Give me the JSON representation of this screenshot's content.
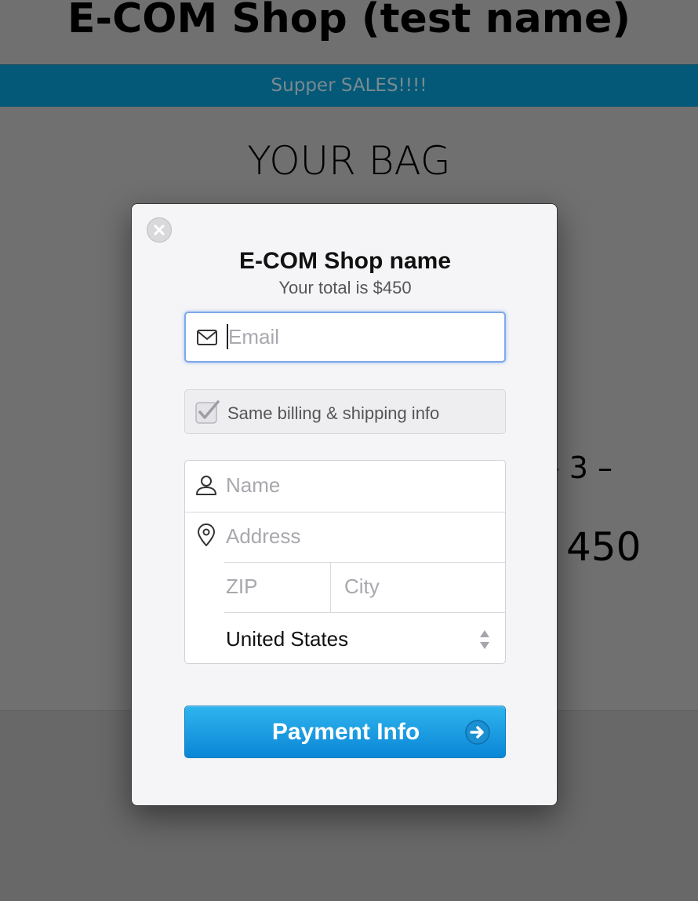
{
  "page": {
    "shop_title": "E-COM Shop (test name)",
    "promo_text": "Supper SALES!!!!",
    "bag_title": "YOUR BAG",
    "quantity_text": "- 3 –",
    "price_text": "450"
  },
  "modal": {
    "title": "E-COM Shop name",
    "subtitle": "Your total is $450",
    "email_placeholder": "Email",
    "same_info_label": "Same billing & shipping info",
    "same_info_checked": true,
    "name_placeholder": "Name",
    "address_placeholder": "Address",
    "zip_placeholder": "ZIP",
    "city_placeholder": "City",
    "country": "United States",
    "submit_label": "Payment Info"
  },
  "icons": {
    "close": "close-icon",
    "email": "envelope-icon",
    "name": "person-icon",
    "address": "map-pin-icon",
    "select": "select-arrows-icon",
    "submit": "arrow-right-icon"
  },
  "colors": {
    "overlay_bg": "#686868",
    "promo_bar": "#045978",
    "button_top": "#2fb4ee",
    "button_bottom": "#0a86d6",
    "focus_border": "#7ea8e8"
  }
}
